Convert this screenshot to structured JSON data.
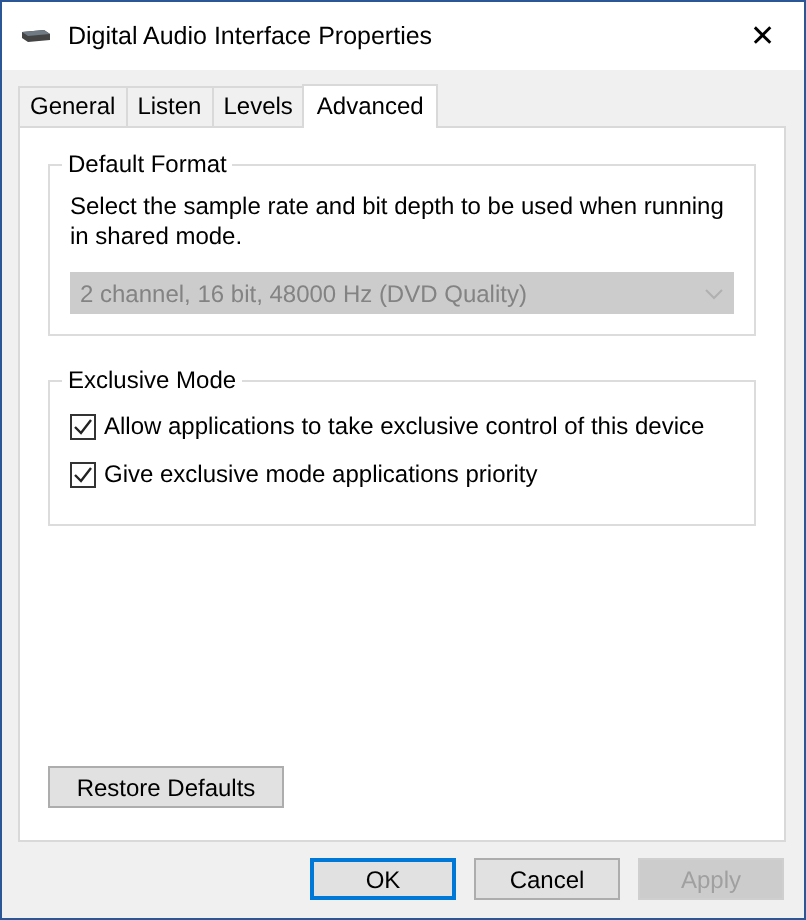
{
  "window": {
    "title": "Digital Audio Interface Properties",
    "close": "✕"
  },
  "tabs": [
    {
      "label": "General",
      "selected": false
    },
    {
      "label": "Listen",
      "selected": false
    },
    {
      "label": "Levels",
      "selected": false
    },
    {
      "label": "Advanced",
      "selected": true
    }
  ],
  "default_format": {
    "title": "Default Format",
    "description": "Select the sample rate and bit depth to be used when running in shared mode.",
    "format": {
      "value": "2 channel, 16 bit, 48000 Hz (DVD Quality)",
      "disabled": true
    }
  },
  "exclusive_mode": {
    "title": "Exclusive Mode",
    "options": [
      {
        "label": "Allow applications to take exclusive control of this device",
        "checked": true
      },
      {
        "label": "Give exclusive mode applications priority",
        "checked": true
      }
    ]
  },
  "restore_button": "Restore Defaults",
  "buttons": [
    {
      "label": "OK",
      "default": true,
      "disabled": false
    },
    {
      "label": "Cancel",
      "default": false,
      "disabled": false
    },
    {
      "label": "Apply",
      "default": false,
      "disabled": true
    }
  ]
}
